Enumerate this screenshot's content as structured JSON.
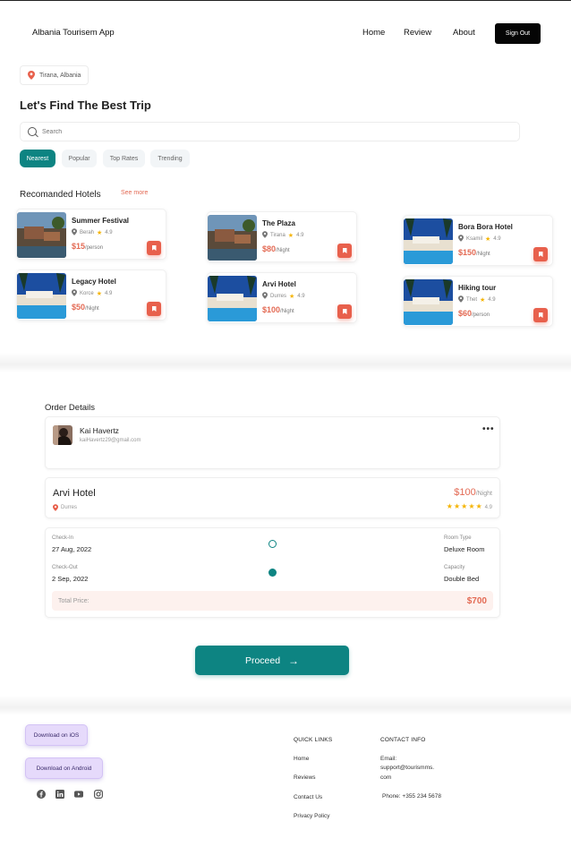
{
  "header": {
    "brand": "Albania Tourisem App",
    "nav": [
      "Home",
      "Review",
      "About"
    ],
    "signout": "Sign Out"
  },
  "location": "Tirana, Albania",
  "hero_title": "Let's Find The Best Trip",
  "search": {
    "placeholder": "Search"
  },
  "filters": [
    "Nearest",
    "Popular",
    "Top Rates",
    "Trending"
  ],
  "active_filter": "Nearest",
  "hotels_section": {
    "title": "Recomanded Hotels",
    "see_more": "See more"
  },
  "hotels": [
    {
      "name": "Summer Festival",
      "city": "Berah",
      "rating": "4.9",
      "price": "$15",
      "unit": "/person"
    },
    {
      "name": "Legacy Hotel",
      "city": "Korce",
      "rating": "4.9",
      "price": "$50",
      "unit": "/Night"
    },
    {
      "name": "The Plaza",
      "city": "Tirana",
      "rating": "4.9",
      "price": "$80",
      "unit": "/Night"
    },
    {
      "name": "Arvi Hotel",
      "city": "Durres",
      "rating": "4.9",
      "price": "$100",
      "unit": "/Night"
    },
    {
      "name": "Bora Bora Hotel",
      "city": "Ksamil",
      "rating": "4.9",
      "price": "$150",
      "unit": "/Night"
    },
    {
      "name": "Hiking tour",
      "city": "Thet",
      "rating": "4.9",
      "price": "$60",
      "unit": "/person"
    }
  ],
  "order": {
    "title": "Order Details",
    "user": {
      "name": "Kai Havertz",
      "email": "kaiHavertz29@gmail.com",
      "menu": "•••"
    },
    "hotel": {
      "name": "Arvi Hotel",
      "city": "Durres",
      "price": "$100",
      "unit": "/Night",
      "rating": "4.9",
      "stars": "★★★★★"
    },
    "checkin_label": "Check-In",
    "checkin": "27 Aug, 2022",
    "checkout_label": "Check-Out",
    "checkout": "2 Sep, 2022",
    "room_label": "Room Type",
    "room": "Deluxe Room",
    "capacity_label": "Capacity",
    "capacity": "Double Bed",
    "total_label": "Total Price:",
    "total": "$700"
  },
  "proceed": {
    "label": "Proceed",
    "arrow": "→"
  },
  "footer": {
    "ios": "Download on iOS",
    "android": "Download on  Android",
    "quick_links_title": "QUICK LINKS",
    "quick_links": [
      "Home",
      "Reviews",
      "Contact Us",
      "Privacy Policy"
    ],
    "contact_title": "CONTACT INFO",
    "email_label": "Email:",
    "email_line1": "support@tourismms.",
    "email_line2": "com",
    "phone": "Phone: +355 234 5678"
  },
  "colors": {
    "accent": "#0d8482",
    "price": "#e36a54",
    "bookmark": "#e8604c",
    "download_bg": "#e6dafb"
  },
  "icons": [
    "map-pin-icon",
    "search-icon",
    "star-icon",
    "bookmark-icon",
    "facebook-icon",
    "linkedin-icon",
    "youtube-icon",
    "instagram-icon",
    "arrow-right-icon"
  ]
}
